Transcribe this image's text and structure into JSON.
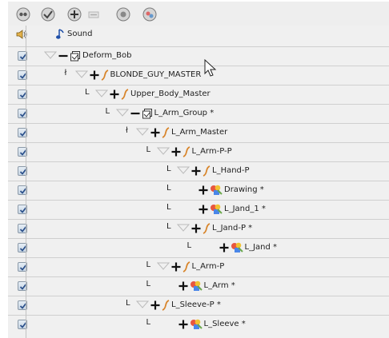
{
  "toolbar": {
    "buttons": [
      {
        "name": "node-view-icon"
      },
      {
        "name": "show-all-icon"
      },
      {
        "name": "add-layer-icon"
      },
      {
        "name": "remove-layer-icon"
      },
      {
        "name": "add-peg-icon"
      },
      {
        "name": "add-drawing-icon"
      }
    ]
  },
  "sound_row": {
    "label": "Sound"
  },
  "layers": [
    {
      "label": "Deform_Bob",
      "connector": "",
      "expand": "minus",
      "type": "deform",
      "col": 0
    },
    {
      "label": "BLONDE_GUY_MASTER",
      "connector": "ł",
      "expand": "plus",
      "type": "peg",
      "col": 1
    },
    {
      "label": "Upper_Body_Master",
      "connector": "L",
      "expand": "plus",
      "type": "peg",
      "col": 2
    },
    {
      "label": "L_Arm_Group *",
      "connector": "L",
      "expand": "minus",
      "type": "deform",
      "col": 3
    },
    {
      "label": "L_Arm_Master",
      "connector": "ł",
      "expand": "plus",
      "type": "peg",
      "col": 4
    },
    {
      "label": "L_Arm-P-P",
      "connector": "L",
      "expand": "plus",
      "type": "peg",
      "col": 5
    },
    {
      "label": "L_Hand-P",
      "connector": "L",
      "expand": "plus",
      "type": "peg",
      "col": 6
    },
    {
      "label": "Drawing *",
      "connector": "L",
      "expand": "plus",
      "type": "drawing",
      "col": 6
    },
    {
      "label": "L_Jand_1 *",
      "connector": "L",
      "expand": "plus",
      "type": "drawing",
      "col": 6
    },
    {
      "label": "L_Jand-P *",
      "connector": "L",
      "expand": "plus",
      "type": "peg",
      "col": 6
    },
    {
      "label": "L_Jand *",
      "connector": "L",
      "expand": "plus",
      "type": "drawing",
      "col": 7
    },
    {
      "label": "L_Arm-P",
      "connector": "L",
      "expand": "plus",
      "type": "peg",
      "col": 5
    },
    {
      "label": "L_Arm *",
      "connector": "L",
      "expand": "plus",
      "type": "drawing",
      "col": 5
    },
    {
      "label": "L_Sleeve-P *",
      "connector": "L",
      "expand": "plus",
      "type": "peg",
      "col": 4
    },
    {
      "label": "L_Sleeve *",
      "connector": "L",
      "expand": "plus",
      "type": "drawing",
      "col": 5
    }
  ],
  "colors": {
    "accent_blue": "#1f4fa8",
    "checkmark": "#2a4f8a",
    "peg_orange": "#d8852b"
  }
}
